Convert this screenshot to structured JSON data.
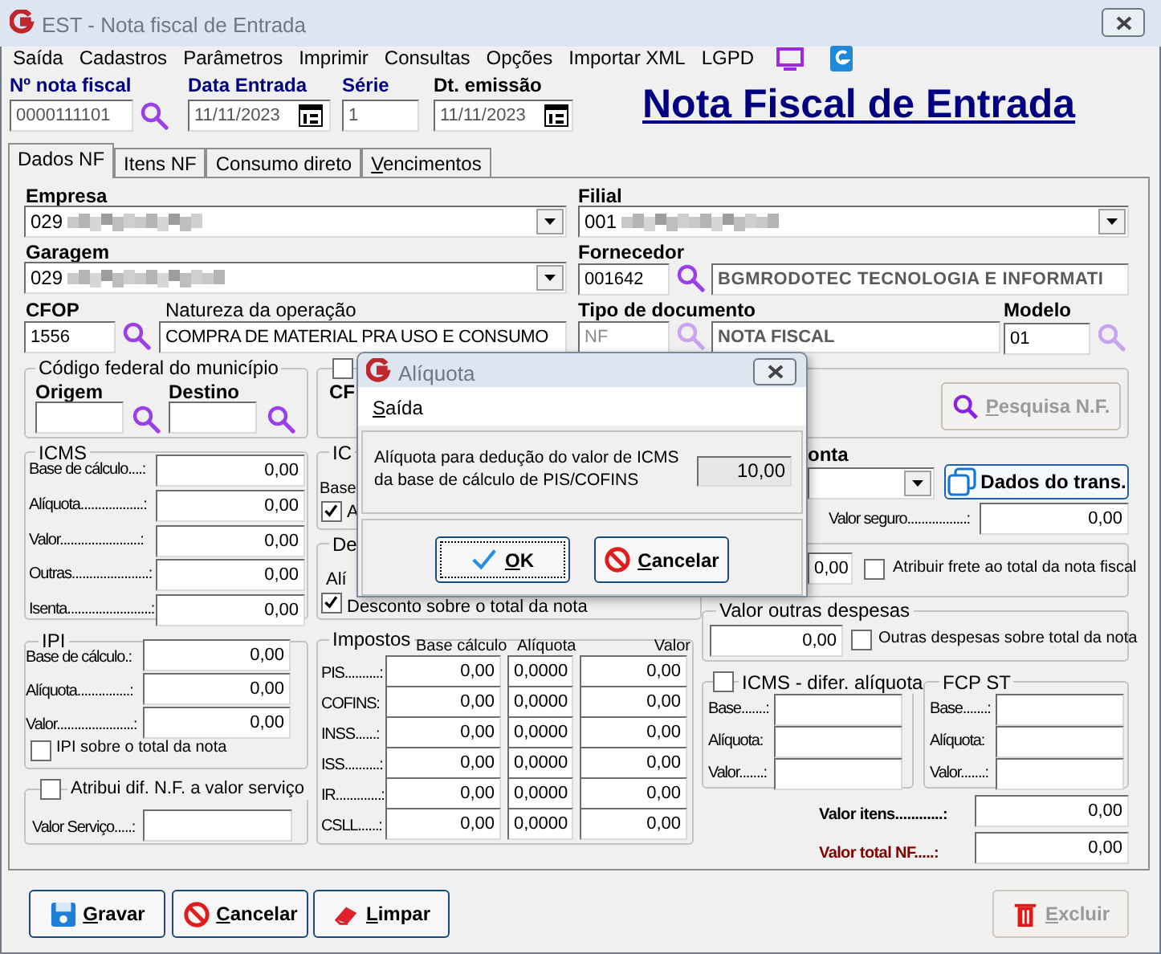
{
  "window": {
    "title": "EST - Nota fiscal de Entrada"
  },
  "menu": [
    {
      "label": "Saída"
    },
    {
      "label": "Cadastros"
    },
    {
      "label": "Parâmetros"
    },
    {
      "label": "Imprimir"
    },
    {
      "label": "Consultas"
    },
    {
      "label": "Opções"
    },
    {
      "label": "Importar XML"
    },
    {
      "label": "LGPD"
    }
  ],
  "header": {
    "nota_fiscal": {
      "label": "Nº nota fiscal",
      "value": "0000111101"
    },
    "data_entrada": {
      "label": "Data Entrada",
      "value": "11/11/2023"
    },
    "serie": {
      "label": "Série",
      "value": "1"
    },
    "dt_emissao": {
      "label": "Dt. emissão",
      "value": "11/11/2023"
    },
    "heading": "Nota Fiscal de Entrada"
  },
  "tabs": [
    {
      "label": "Dados NF",
      "selected": true
    },
    {
      "label": "Itens NF",
      "selected": false
    },
    {
      "label": "Consumo direto",
      "selected": false
    },
    {
      "label": "Vencimentos",
      "selected": false
    }
  ],
  "empresa": {
    "label": "Empresa",
    "value": "029"
  },
  "filial": {
    "label": "Filial",
    "value": "001"
  },
  "garagem": {
    "label": "Garagem",
    "value": "029"
  },
  "fornecedor": {
    "label": "Fornecedor",
    "code": "001642",
    "name": "BGMRODOTEC TECNOLOGIA E INFORMATI"
  },
  "cfop": {
    "label": "CFOP",
    "value": "1556"
  },
  "natureza": {
    "label": "Natureza da operação",
    "value": "COMPRA DE MATERIAL PRA USO E CONSUMO"
  },
  "tipo_documento": {
    "label": "Tipo de documento",
    "code": "NF",
    "name": "NOTA FISCAL"
  },
  "modelo": {
    "label": "Modelo",
    "value": "01"
  },
  "municipio": {
    "title": "Código federal do município",
    "origem": "Origem",
    "destino": "Destino"
  },
  "cfop_group": {
    "label": "CF",
    "checked": false
  },
  "icms": {
    "title": "ICMS",
    "rows": [
      {
        "label": "Base de cálculo....:",
        "value": "0,00"
      },
      {
        "label": "Alíquota..................:",
        "value": "0,00"
      },
      {
        "label": "Valor.......................:",
        "value": "0,00"
      },
      {
        "label": "Outras......................:",
        "value": "0,00"
      },
      {
        "label": "Isenta........................:",
        "value": "0,00"
      }
    ]
  },
  "icms_st": {
    "title": "IC",
    "label": "Base",
    "check_label": "A",
    "checked": true
  },
  "desconto": {
    "title": "De",
    "label": "Alí",
    "check_label": "Desconto sobre o total da nota",
    "checked": true
  },
  "pesquisa_button": {
    "label": "Pesquisa N.F.",
    "disabled": true
  },
  "conta": {
    "label": "onta"
  },
  "dados_trans_button": {
    "label": "Dados do trans."
  },
  "valor_seguro": {
    "label": "Valor seguro.................:",
    "value": "0,00"
  },
  "frete": {
    "value": "0,00",
    "check_label": "Atribuir frete ao total da nota fiscal",
    "checked": false
  },
  "outras_despesas": {
    "title": "Valor outras despesas",
    "value": "0,00",
    "check_label": "Outras despesas sobre total da nota",
    "checked": false
  },
  "icms_difer": {
    "title": "ICMS - difer. alíquota",
    "checked": false,
    "rows": [
      {
        "label": "Base.......:"
      },
      {
        "label": "Alíquota:"
      },
      {
        "label": "Valor.......:"
      }
    ]
  },
  "fcp_st": {
    "title": "FCP ST",
    "rows": [
      {
        "label": "Base.......:"
      },
      {
        "label": "Alíquota:"
      },
      {
        "label": "Valor.......:"
      }
    ]
  },
  "valor_itens": {
    "label": "Valor itens............:",
    "value": "0,00"
  },
  "valor_total": {
    "label": "Valor total NF.....:",
    "value": "0,00"
  },
  "ipi": {
    "title": "IPI",
    "rows": [
      {
        "label": "Base de cálculo.:",
        "value": "0,00"
      },
      {
        "label": "Alíquota...............:",
        "value": "0,00"
      },
      {
        "label": "Valor......................:",
        "value": "0,00"
      }
    ],
    "check_label": "IPI sobre o total da nota",
    "checked": false
  },
  "servico": {
    "check_label": "Atribui dif. N.F. a valor serviço",
    "checked": false,
    "label": "Valor Serviço.....:"
  },
  "impostos": {
    "title": "Impostos",
    "columns": [
      "Base cálculo",
      "Alíquota",
      "Valor"
    ],
    "rows": [
      {
        "label": "PIS..........:",
        "base": "0,00",
        "aliquota": "0,0000",
        "valor": "0,00"
      },
      {
        "label": "COFINS:",
        "base": "0,00",
        "aliquota": "0,0000",
        "valor": "0,00"
      },
      {
        "label": "INSS......:",
        "base": "0,00",
        "aliquota": "0,0000",
        "valor": "0,00"
      },
      {
        "label": "ISS..........:",
        "base": "0,00",
        "aliquota": "0,0000",
        "valor": "0,00"
      },
      {
        "label": "IR.............:",
        "base": "0,00",
        "aliquota": "0,0000",
        "valor": "0,00"
      },
      {
        "label": "CSLL......:",
        "base": "0,00",
        "aliquota": "0,0000",
        "valor": "0,00"
      }
    ]
  },
  "buttons": [
    {
      "label": "Gravar",
      "kind": "save",
      "disabled": false
    },
    {
      "label": "Cancelar",
      "kind": "cancel",
      "disabled": false
    },
    {
      "label": "Limpar",
      "kind": "clear",
      "disabled": false
    },
    {
      "label": "Excluir",
      "kind": "delete",
      "disabled": true
    }
  ],
  "dialog": {
    "title": "Alíquota",
    "menu": "Saída",
    "message": "Alíquota para dedução do valor de ICMS da base de cálculo de PIS/COFINS",
    "value": "10,00",
    "buttons": [
      {
        "label": "OK",
        "kind": "ok"
      },
      {
        "label": "Cancelar",
        "kind": "cancel"
      }
    ]
  }
}
